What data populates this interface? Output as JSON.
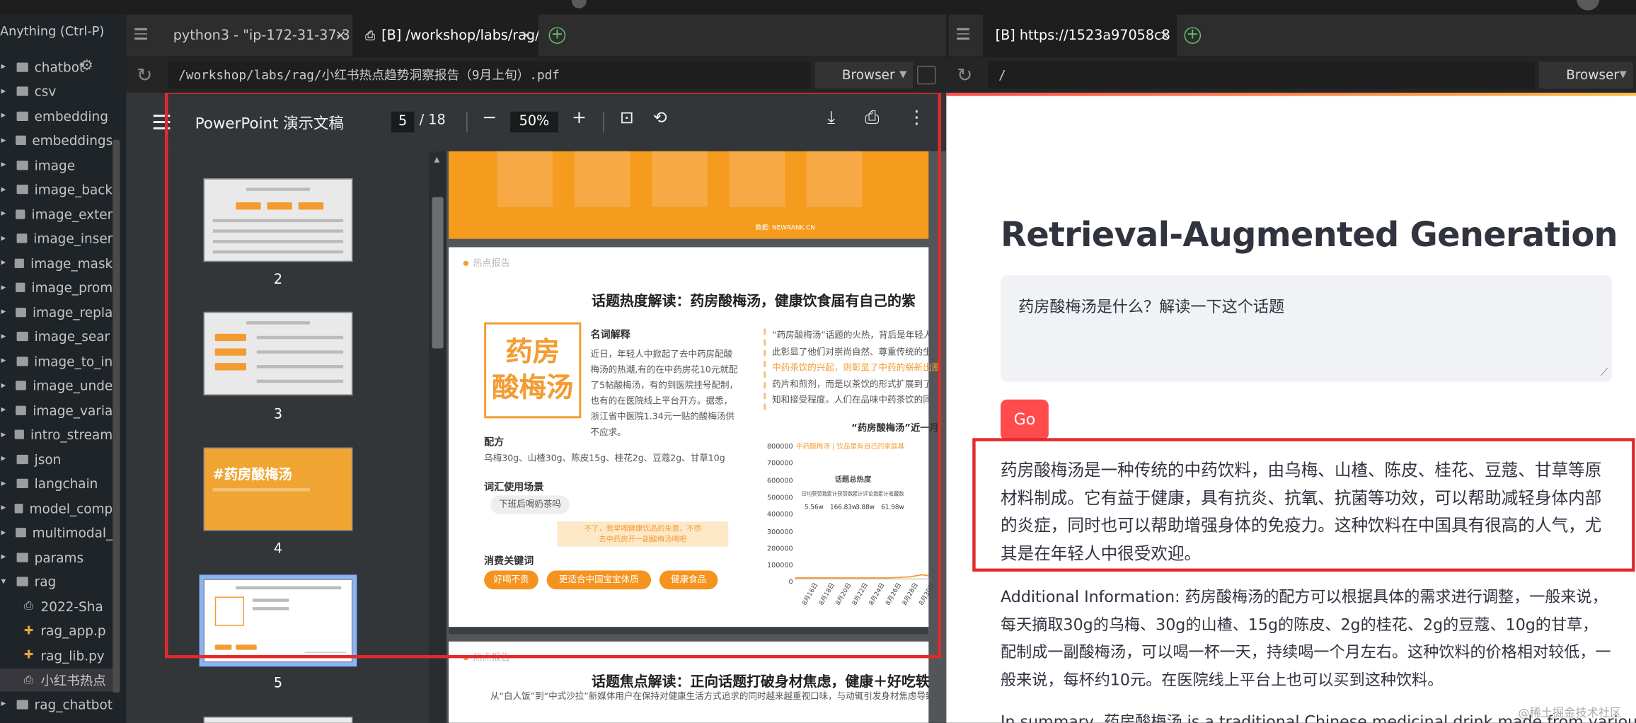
{
  "sidebar": {
    "search_hint": "Anything (Ctrl-P)",
    "items": [
      {
        "label": "chatbot",
        "type": "folder"
      },
      {
        "label": "csv",
        "type": "folder"
      },
      {
        "label": "embedding",
        "type": "folder"
      },
      {
        "label": "embeddings",
        "type": "folder"
      },
      {
        "label": "image",
        "type": "folder"
      },
      {
        "label": "image_back",
        "type": "folder"
      },
      {
        "label": "image_exter",
        "type": "folder"
      },
      {
        "label": "image_inser",
        "type": "folder"
      },
      {
        "label": "image_mask",
        "type": "folder"
      },
      {
        "label": "image_prom",
        "type": "folder"
      },
      {
        "label": "image_repla",
        "type": "folder"
      },
      {
        "label": "image_sear",
        "type": "folder"
      },
      {
        "label": "image_to_in",
        "type": "folder"
      },
      {
        "label": "image_unde",
        "type": "folder"
      },
      {
        "label": "image_varia",
        "type": "folder"
      },
      {
        "label": "intro_stream",
        "type": "folder"
      },
      {
        "label": "json",
        "type": "folder"
      },
      {
        "label": "langchain",
        "type": "folder"
      },
      {
        "label": "model_comp",
        "type": "folder"
      },
      {
        "label": "multimodal_",
        "type": "folder"
      },
      {
        "label": "params",
        "type": "folder"
      },
      {
        "label": "rag",
        "type": "folder-open"
      },
      {
        "label": "2022-Sha",
        "type": "pdf"
      },
      {
        "label": "rag_app.p",
        "type": "py"
      },
      {
        "label": "rag_lib.py",
        "type": "py"
      },
      {
        "label": "小红书热点",
        "type": "pdf",
        "selected": true
      },
      {
        "label": "rag_chatbot",
        "type": "folder"
      }
    ]
  },
  "left_tabs": [
    {
      "label": "python3 - \"ip-172-31-37-3",
      "active": false
    },
    {
      "label": "[B] /workshop/labs/rag/",
      "active": true
    }
  ],
  "left_address": "/workshop/labs/rag/小红书热点趋势洞察报告（9月上旬）.pdf",
  "browser_label": "Browser",
  "right_tab": {
    "label": "[B] https://1523a97058c8"
  },
  "right_address": "/",
  "pdf": {
    "title": "PowerPoint 演示文稿",
    "current_page": "5",
    "total_pages": "/ 18",
    "zoom": "50%",
    "thumbnails": [
      {
        "label": "2"
      },
      {
        "label": "3"
      },
      {
        "label": "4",
        "title": "#药房酸梅汤"
      },
      {
        "label": "5"
      }
    ],
    "banner_source": "数据: NEWRANK.CN",
    "page1": {
      "section_tag": "热点报告",
      "heading": "话题热度解读：药房酸梅汤，健康饮食届有自己的紫",
      "logo_text": "药房酸梅汤",
      "term_title": "名词解释",
      "term_text": "近日，年轻人中掀起了去中药房配酸梅汤的热潮,有的在中药房花10元就配了5帖酸梅汤，有的到医院挂号配制，也有的在医院线上平台开方。据悉，浙江省中医院1.34元一贴的酸梅汤供不应求。",
      "recipe_title": "配方",
      "recipe_text": "乌梅30g、山楂30g、陈皮15g、桂花2g、豆蔻2g、甘草10g",
      "scene_title": "词汇使用场景",
      "scene_chip": "下班后喝奶茶吗",
      "note_line1": "不了，我早喝健康饮品的朱恩，不然",
      "note_line2": "去中药房开一副酸梅汤喝吧",
      "keywords_title": "消费关键词",
      "keywords": [
        "好喝不贵",
        "更适合中国宝宝体质",
        "健康食品"
      ],
      "quote_lines": [
        "“药房酸梅汤”话题的火热，背后是年轻人们对",
        "此彰显了他们对崇尚自然、尊重传统的生活",
        "中药茶饮的兴起，则彰显了中药的崭新出圈",
        "药片和煎剂，而是以茶饮的形式扩展到了更",
        "知和接受程度。人们在品味中药茶饮的同时"
      ],
      "chart_title": "“药房酸梅汤”近一月",
      "chart_subtitle": "中药酸梅汤 | 饮品里有自己的家庭基",
      "stats_title": "话题总热度",
      "stats": [
        {
          "label": "日均获赞数",
          "value": "5.56w"
        },
        {
          "label": "累计获赞数",
          "value": "166.83w"
        },
        {
          "label": "累计评论数",
          "value": "3.88w"
        },
        {
          "label": "累计收藏数",
          "value": "61.98w"
        }
      ],
      "y_ticks": [
        "800000",
        "700000",
        "600000",
        "500000",
        "400000",
        "300000",
        "200000",
        "100000",
        "0"
      ],
      "x_ticks": [
        "8月16日",
        "8月18日",
        "8月20日",
        "8月22日",
        "8月24日",
        "8月26日",
        "8月28日",
        "8月30日"
      ]
    },
    "page2": {
      "section_tag": "热点报告",
      "heading": "话题焦点解读：正向话题打破身材焦虑，健康＋好吃轶",
      "text": "从“白人饭”到“中式沙拉”新媒体用户在保持对健康生活方式追求的同时越来越重视口味，与动辄引发身材焦虑导致评论"
    }
  },
  "app": {
    "title": "Retrieval-Augmented Generation",
    "question": "药房酸梅汤是什么？解读一下这个话题",
    "go_label": "Go",
    "answer": "药房酸梅汤是一种传统的中药饮料，由乌梅、山楂、陈皮、桂花、豆蔻、甘草等原材料制成。它有益于健康，具有抗炎、抗氧、抗菌等功效，可以帮助减轻身体内部的炎症，同时也可以帮助增强身体的免疫力。这种饮料在中国具有很高的人气，尤其是在年轻人中很受欢迎。",
    "additional": "Additional Information: 药房酸梅汤的配方可以根据具体的需求进行调整，一般来说，每天摘取30g的乌梅、30g的山楂、15g的陈皮、2g的桂花、2g的豆蔻、10g的甘草，配制成一副酸梅汤，可以喝一杯一天，持续喝一个月左右。这种饮料的价格相对较低，一般来说，每杯约10元。在医院线上平台上也可以买到这种饮料。",
    "summary": "In summary, 药房酸梅汤 is a traditional Chinese medicinal drink made from various"
  },
  "watermark": "@稀土掘金技术社区",
  "colors": {
    "highlight_red": "#e32a2a",
    "accent": "#ff4b4b",
    "pdf_orange": "#f39c32"
  }
}
